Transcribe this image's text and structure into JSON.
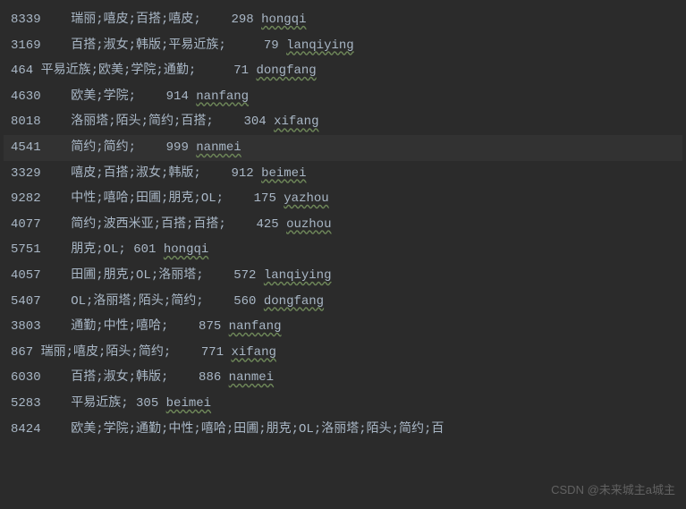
{
  "rows": [
    {
      "id": "8339",
      "tags": "瑞丽;嘻皮;百搭;嘻皮;",
      "num": "298",
      "word": "hongqi",
      "hl": false,
      "indent": true
    },
    {
      "id": "3169",
      "tags": "百搭;淑女;韩版;平易近族;",
      "num": "79",
      "word": "lanqiying",
      "hl": false,
      "indent": true
    },
    {
      "id": "464",
      "tags": "平易近族;欧美;学院;通勤;",
      "num": "71",
      "word": "dongfang",
      "hl": false,
      "indent": false
    },
    {
      "id": "4630",
      "tags": "欧美;学院;",
      "num": "914",
      "word": "nanfang",
      "hl": false,
      "indent": true
    },
    {
      "id": "8018",
      "tags": "洛丽塔;陌头;简约;百搭;",
      "num": "304",
      "word": "xifang",
      "hl": false,
      "indent": true
    },
    {
      "id": "4541",
      "tags": "简约;简约;",
      "num": "999",
      "word": "nanmei",
      "hl": true,
      "indent": true
    },
    {
      "id": "3329",
      "tags": "嘻皮;百搭;淑女;韩版;",
      "num": "912",
      "word": "beimei",
      "hl": false,
      "indent": true
    },
    {
      "id": "9282",
      "tags": "中性;嘻哈;田圃;朋克;OL;",
      "num": "175",
      "word": "yazhou",
      "hl": false,
      "indent": true
    },
    {
      "id": "4077",
      "tags": "简约;波西米亚;百搭;百搭;",
      "num": "425",
      "word": "ouzhou",
      "hl": false,
      "indent": true
    },
    {
      "id": "5751",
      "tags": "朋克;OL;",
      "num": "601",
      "word": "hongqi",
      "hl": false,
      "indent": true
    },
    {
      "id": "4057",
      "tags": "田圃;朋克;OL;洛丽塔;",
      "num": "572",
      "word": "lanqiying",
      "hl": false,
      "indent": true
    },
    {
      "id": "5407",
      "tags": "OL;洛丽塔;陌头;简约;",
      "num": "560",
      "word": "dongfang",
      "hl": false,
      "indent": true
    },
    {
      "id": "3803",
      "tags": "通勤;中性;嘻哈;",
      "num": "875",
      "word": "nanfang",
      "hl": false,
      "indent": true
    },
    {
      "id": "867",
      "tags": "瑞丽;嘻皮;陌头;简约;",
      "num": "771",
      "word": "xifang",
      "hl": false,
      "indent": false
    },
    {
      "id": "6030",
      "tags": "百搭;淑女;韩版;",
      "num": "886",
      "word": "nanmei",
      "hl": false,
      "indent": true
    },
    {
      "id": "5283",
      "tags": "平易近族;",
      "num": "305",
      "word": "beimei",
      "hl": false,
      "indent": true
    },
    {
      "id": "8424",
      "tags": "欧美;学院;通勤;中性;嘻哈;田圃;朋克;OL;洛丽塔;陌头;简约;百",
      "num": "",
      "word": "",
      "hl": false,
      "indent": true
    }
  ],
  "watermark": "CSDN @未来城主a城主"
}
